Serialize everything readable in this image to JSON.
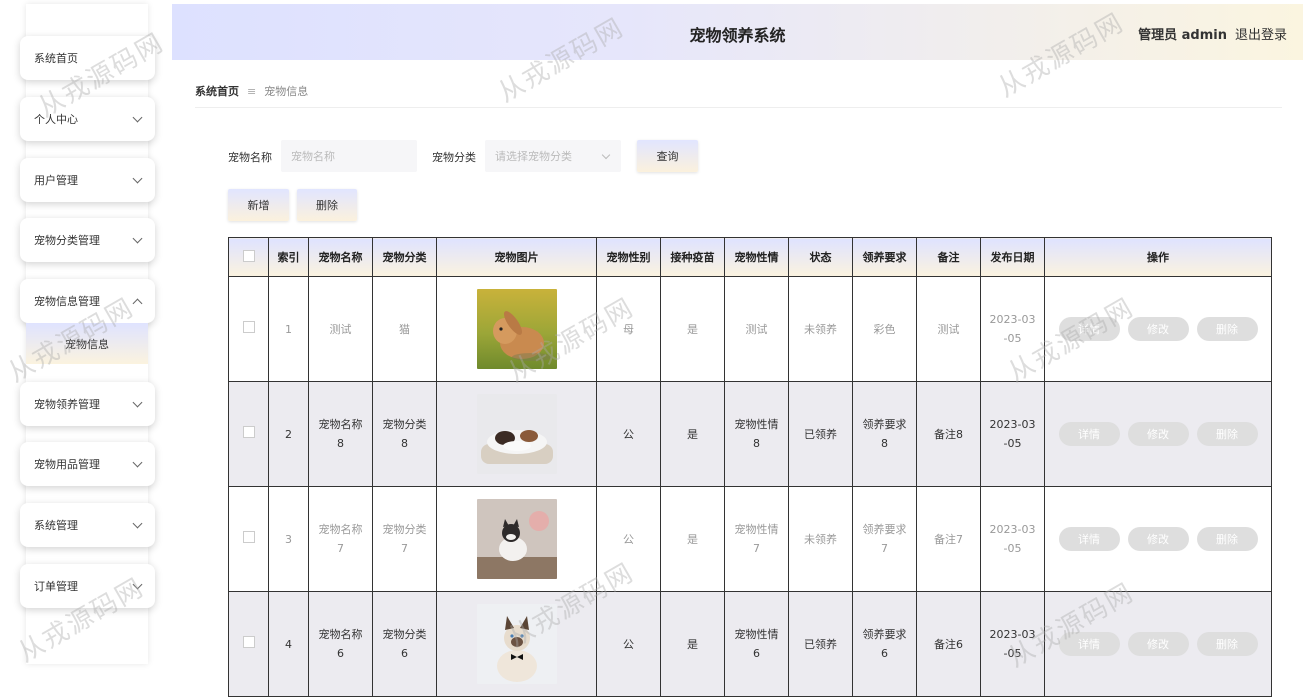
{
  "header": {
    "title": "宠物领养系统",
    "admin": "管理员 admin",
    "logout": "退出登录"
  },
  "sidebar": {
    "items": [
      {
        "label": "系统首页"
      },
      {
        "label": "个人中心"
      },
      {
        "label": "用户管理"
      },
      {
        "label": "宠物分类管理"
      },
      {
        "label": "宠物信息管理"
      },
      {
        "label": "宠物领养管理"
      },
      {
        "label": "宠物用品管理"
      },
      {
        "label": "系统管理"
      },
      {
        "label": "订单管理"
      }
    ],
    "active_sub": "宠物信息"
  },
  "breadcrumb": {
    "home": "系统首页",
    "sep": "≡",
    "current": "宠物信息"
  },
  "search": {
    "name_label": "宠物名称",
    "name_placeholder": "宠物名称",
    "category_label": "宠物分类",
    "category_placeholder": "请选择宠物分类",
    "query": "查询"
  },
  "actions": {
    "add": "新增",
    "delete": "删除"
  },
  "table": {
    "headers": [
      "索引",
      "宠物名称",
      "宠物分类",
      "宠物图片",
      "宠物性别",
      "接种疫苗",
      "宠物性情",
      "状态",
      "领养要求",
      "备注",
      "发布日期",
      "操作"
    ],
    "op_labels": [
      "详情",
      "修改",
      "删除"
    ],
    "rows": [
      {
        "idx": "1",
        "name": "测试",
        "cat": "猫",
        "img": "rabbit-photo",
        "sex": "母",
        "vaccine": "是",
        "temper": "测试",
        "status": "未领养",
        "req": "彩色",
        "remark": "测试",
        "date": "2023-03\n-05"
      },
      {
        "idx": "2",
        "name": "宠物名称\n8",
        "cat": "宠物分类\n8",
        "img": "sleeping-dogs-photo",
        "sex": "公",
        "vaccine": "是",
        "temper": "宠物性情\n8",
        "status": "已领养",
        "req": "领养要求\n8",
        "remark": "备注8",
        "date": "2023-03\n-05"
      },
      {
        "idx": "3",
        "name": "宠物名称\n7",
        "cat": "宠物分类\n7",
        "img": "cat-photo",
        "sex": "公",
        "vaccine": "是",
        "temper": "宠物性情\n7",
        "status": "未领养",
        "req": "领养要求\n7",
        "remark": "备注7",
        "date": "2023-03\n-05"
      },
      {
        "idx": "4",
        "name": "宠物名称\n6",
        "cat": "宠物分类\n6",
        "img": "siamese-cat-photo",
        "sex": "公",
        "vaccine": "是",
        "temper": "宠物性情\n6",
        "status": "已领养",
        "req": "领养要求\n6",
        "remark": "备注6",
        "date": "2023-03\n-05"
      }
    ]
  },
  "watermark": "从戎源码网",
  "colors": {
    "accent_start": "#dfe3ff",
    "accent_end": "#fbf3df",
    "op_button": "#dedede"
  }
}
